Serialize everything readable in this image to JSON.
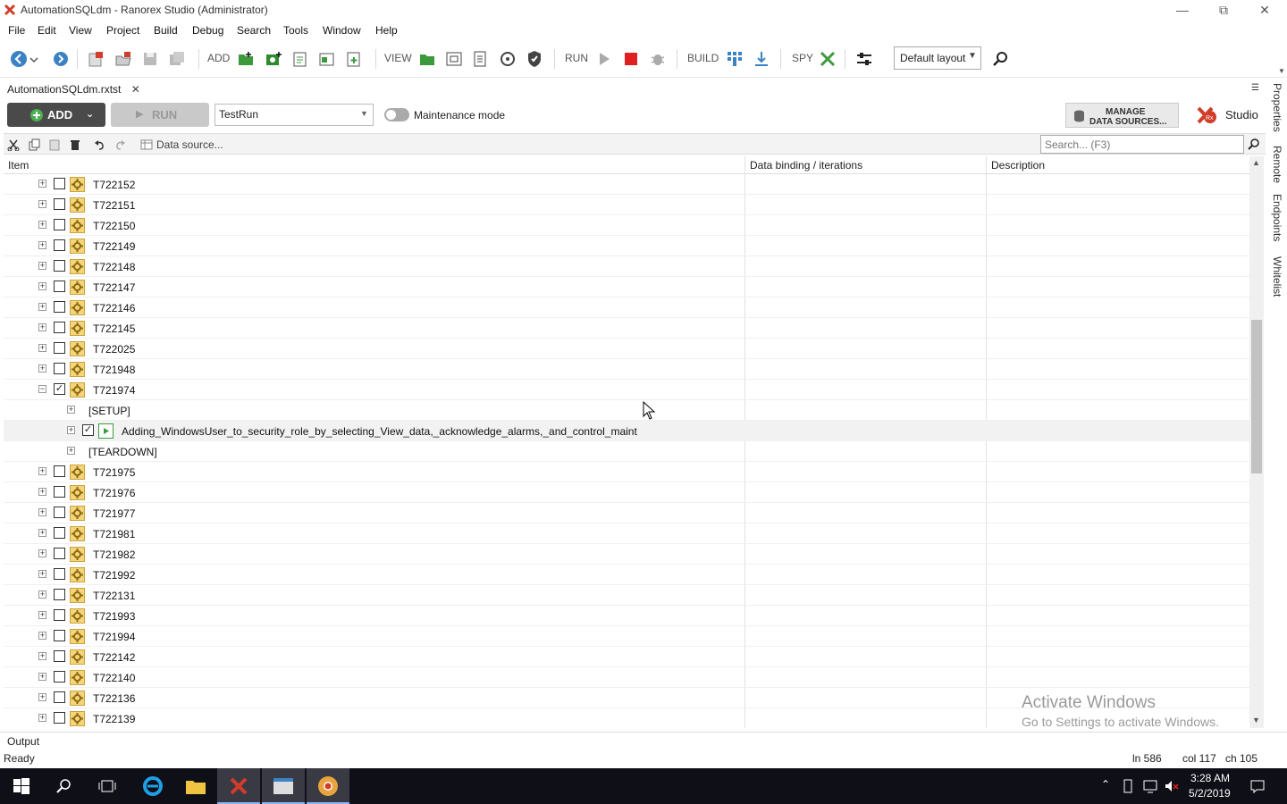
{
  "window": {
    "title": "AutomationSQLdm - Ranorex Studio (Administrator)"
  },
  "menu": [
    "File",
    "Edit",
    "View",
    "Project",
    "Build",
    "Debug",
    "Search",
    "Tools",
    "Window",
    "Help"
  ],
  "toolbar": {
    "add_label": "ADD",
    "view_label": "VIEW",
    "run_label": "RUN",
    "build_label": "BUILD",
    "spy_label": "SPY",
    "layout_value": "Default layout"
  },
  "doc_tab": {
    "name": "AutomationSQLdm.rxtst"
  },
  "actions": {
    "add_label": "ADD",
    "run_label": "RUN",
    "testrun_value": "TestRun",
    "maintenance_label": "Maintenance mode",
    "manage_line1": "MANAGE",
    "manage_line2": "DATA SOURCES...",
    "studio_label": "Studio"
  },
  "datasource": {
    "label": "Data source...",
    "search_placeholder": "Search... (F3)"
  },
  "grid": {
    "columns": [
      "Item",
      "Data binding / iterations",
      "Description"
    ],
    "rows": [
      {
        "label": "T722152",
        "type": "case",
        "level": 0,
        "checked": false,
        "expanded": false
      },
      {
        "label": "T722151",
        "type": "case",
        "level": 0,
        "checked": false,
        "expanded": false
      },
      {
        "label": "T722150",
        "type": "case",
        "level": 0,
        "checked": false,
        "expanded": false
      },
      {
        "label": "T722149",
        "type": "case",
        "level": 0,
        "checked": false,
        "expanded": false
      },
      {
        "label": "T722148",
        "type": "case",
        "level": 0,
        "checked": false,
        "expanded": false
      },
      {
        "label": "T722147",
        "type": "case",
        "level": 0,
        "checked": false,
        "expanded": false
      },
      {
        "label": "T722146",
        "type": "case",
        "level": 0,
        "checked": false,
        "expanded": false
      },
      {
        "label": "T722145",
        "type": "case",
        "level": 0,
        "checked": false,
        "expanded": false
      },
      {
        "label": "T722025",
        "type": "case",
        "level": 0,
        "checked": false,
        "expanded": false
      },
      {
        "label": "T721948",
        "type": "case",
        "level": 0,
        "checked": false,
        "expanded": false
      },
      {
        "label": "T721974",
        "type": "case",
        "level": 0,
        "checked": true,
        "expanded": true
      },
      {
        "label": "[SETUP]",
        "type": "section",
        "level": 1,
        "checked": false,
        "expanded": false
      },
      {
        "label": "Adding_WindowsUser_to_security_role_by_selecting_View_data,_acknowledge_alarms,_and_control_maint",
        "type": "module",
        "level": 1,
        "checked": true,
        "expanded": false
      },
      {
        "label": "[TEARDOWN]",
        "type": "section",
        "level": 1,
        "checked": false,
        "expanded": false
      },
      {
        "label": "T721975",
        "type": "case",
        "level": 0,
        "checked": false,
        "expanded": false
      },
      {
        "label": "T721976",
        "type": "case",
        "level": 0,
        "checked": false,
        "expanded": false
      },
      {
        "label": "T721977",
        "type": "case",
        "level": 0,
        "checked": false,
        "expanded": false
      },
      {
        "label": "T721981",
        "type": "case",
        "level": 0,
        "checked": false,
        "expanded": false
      },
      {
        "label": "T721982",
        "type": "case",
        "level": 0,
        "checked": false,
        "expanded": false
      },
      {
        "label": "T721992",
        "type": "case",
        "level": 0,
        "checked": false,
        "expanded": false
      },
      {
        "label": "T722131",
        "type": "case",
        "level": 0,
        "checked": false,
        "expanded": false
      },
      {
        "label": "T721993",
        "type": "case",
        "level": 0,
        "checked": false,
        "expanded": false
      },
      {
        "label": "T721994",
        "type": "case",
        "level": 0,
        "checked": false,
        "expanded": false
      },
      {
        "label": "T722142",
        "type": "case",
        "level": 0,
        "checked": false,
        "expanded": false
      },
      {
        "label": "T722140",
        "type": "case",
        "level": 0,
        "checked": false,
        "expanded": false
      },
      {
        "label": "T722136",
        "type": "case",
        "level": 0,
        "checked": false,
        "expanded": false
      },
      {
        "label": "T722139",
        "type": "case",
        "level": 0,
        "checked": false,
        "expanded": false
      }
    ]
  },
  "dock_tabs": [
    "Properties",
    "Remote",
    "Endpoints",
    "Whitelist"
  ],
  "output": {
    "label": "Output"
  },
  "status": {
    "text": "Ready",
    "ln": "ln 586",
    "col": "col 117",
    "ch": "ch 105"
  },
  "watermark": {
    "line1": "Activate Windows",
    "line2": "Go to Settings to activate Windows."
  },
  "taskbar": {
    "time": "3:28 AM",
    "date": "5/2/2019"
  },
  "colors": {
    "accent": "#3b82c4",
    "add_button": "#4a4a4a",
    "run_stop": "#e02020",
    "icon_yellow": "#f5d47a"
  }
}
